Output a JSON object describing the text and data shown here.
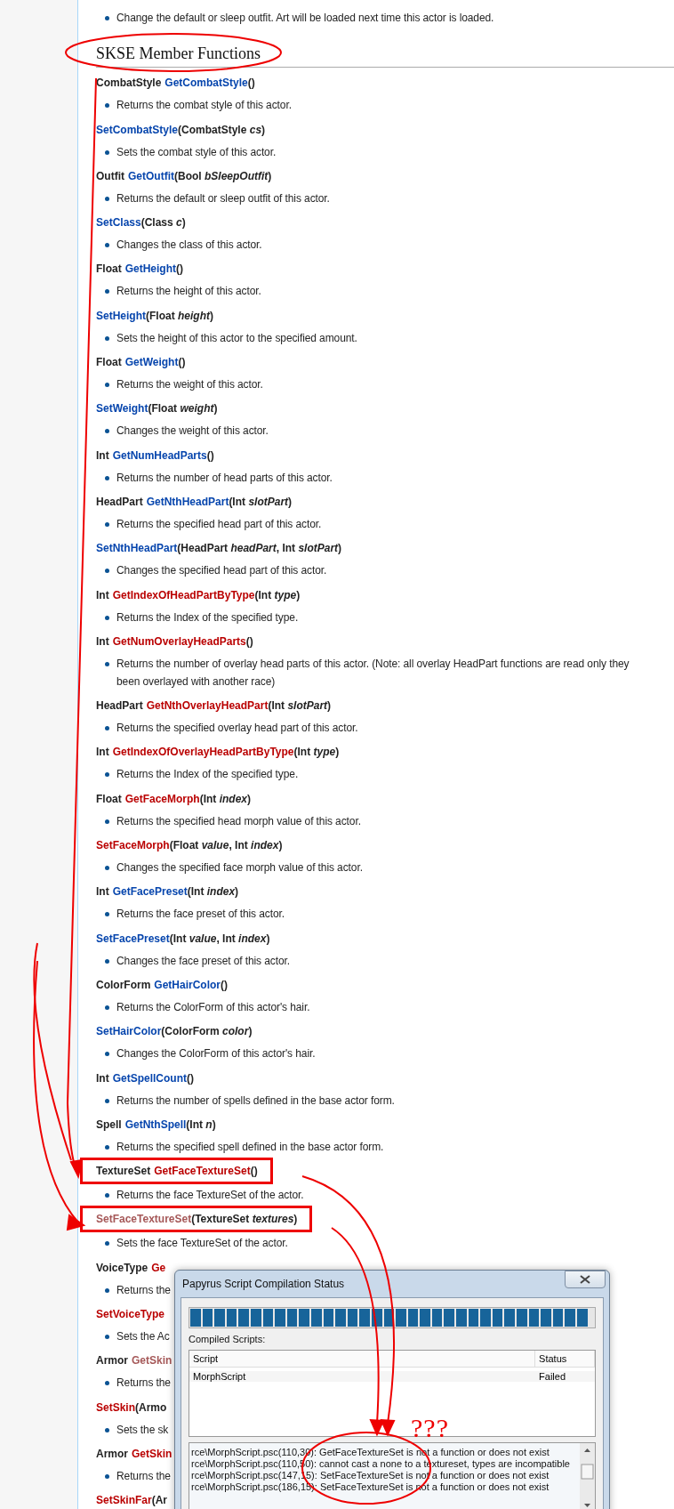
{
  "intro_note": "Change the default or sleep outfit. Art will be loaded next time this actor is loaded.",
  "section": {
    "title": "SKSE Member Functions",
    "circled": true
  },
  "functions": [
    {
      "return_type": "CombatStyle",
      "name": "GetCombatStyle",
      "kind": "blue",
      "params": "()",
      "boxed": false,
      "description": [
        "Returns the combat style of this actor."
      ]
    },
    {
      "name": "SetCombatStyle",
      "kind": "blue",
      "params": "(CombatStyle *cs*)",
      "boxed": false,
      "description": [
        "Sets the combat style of this actor."
      ]
    },
    {
      "return_type": "Outfit",
      "name": "GetOutfit",
      "kind": "blue",
      "params": "(Bool *bSleepOutfit*)",
      "boxed": false,
      "description": [
        "Returns the default or sleep outfit of this actor."
      ]
    },
    {
      "name": "SetClass",
      "kind": "blue",
      "params": "(Class *c*)",
      "boxed": false,
      "description": [
        "Changes the class of this actor."
      ]
    },
    {
      "return_type": "Float",
      "name": "GetHeight",
      "kind": "blue",
      "params": "()",
      "boxed": false,
      "description": [
        "Returns the height of this actor."
      ]
    },
    {
      "name": "SetHeight",
      "kind": "blue",
      "params": "(Float *height*)",
      "boxed": false,
      "description": [
        "Sets the height of this actor to the specified amount."
      ]
    },
    {
      "return_type": "Float",
      "name": "GetWeight",
      "kind": "blue",
      "params": "()",
      "boxed": false,
      "description": [
        "Returns the weight of this actor."
      ]
    },
    {
      "name": "SetWeight",
      "kind": "blue",
      "params": "(Float *weight*)",
      "boxed": false,
      "description": [
        "Changes the weight of this actor."
      ]
    },
    {
      "return_type": "Int",
      "name": "GetNumHeadParts",
      "kind": "blue",
      "params": "()",
      "boxed": false,
      "description": [
        "Returns the number of head parts of this actor."
      ]
    },
    {
      "return_type": "HeadPart",
      "name": "GetNthHeadPart",
      "kind": "blue",
      "params": "(Int *slotPart*)",
      "boxed": false,
      "description": [
        "Returns the specified head part of this actor."
      ]
    },
    {
      "name": "SetNthHeadPart",
      "kind": "blue",
      "params": "(HeadPart *headPart*, Int *slotPart*)",
      "boxed": false,
      "description": [
        "Changes the specified head part of this actor."
      ]
    },
    {
      "return_type": "Int",
      "name": "GetIndexOfHeadPartByType",
      "kind": "red",
      "params": "(Int *type*)",
      "boxed": false,
      "description": [
        "Returns the Index of the specified type."
      ]
    },
    {
      "return_type": "Int",
      "name": "GetNumOverlayHeadParts",
      "kind": "red",
      "params": "()",
      "boxed": false,
      "description": [
        "Returns the number of overlay head parts of this actor. (Note: all overlay HeadPart functions are read only they",
        "been overlayed with another race)"
      ]
    },
    {
      "return_type": "HeadPart",
      "name": "GetNthOverlayHeadPart",
      "kind": "red",
      "params": "(Int *slotPart*)",
      "boxed": false,
      "description": [
        "Returns the specified overlay head part of this actor."
      ]
    },
    {
      "return_type": "Int",
      "name": "GetIndexOfOverlayHeadPartByType",
      "kind": "red",
      "params": "(Int *type*)",
      "boxed": false,
      "description": [
        "Returns the Index of the specified type."
      ]
    },
    {
      "return_type": "Float",
      "name": "GetFaceMorph",
      "kind": "red",
      "params": "(Int *index*)",
      "boxed": false,
      "description": [
        "Returns the specified head morph value of this actor."
      ]
    },
    {
      "name": "SetFaceMorph",
      "kind": "red",
      "params": "(Float *value*, Int *index*)",
      "boxed": false,
      "description": [
        "Changes the specified face morph value of this actor."
      ]
    },
    {
      "return_type": "Int",
      "name": "GetFacePreset",
      "kind": "blue",
      "params": "(Int *index*)",
      "boxed": false,
      "description": [
        "Returns the face preset of this actor."
      ]
    },
    {
      "name": "SetFacePreset",
      "kind": "blue",
      "params": "(Int *value*, Int *index*)",
      "boxed": false,
      "description": [
        "Changes the face preset of this actor."
      ]
    },
    {
      "return_type": "ColorForm",
      "name": "GetHairColor",
      "kind": "blue",
      "params": "()",
      "boxed": false,
      "description": [
        "Returns the ColorForm of this actor's hair."
      ]
    },
    {
      "name": "SetHairColor",
      "kind": "blue",
      "params": "(ColorForm *color*)",
      "boxed": false,
      "description": [
        "Changes the ColorForm of this actor's hair."
      ]
    },
    {
      "return_type": "Int",
      "name": "GetSpellCount",
      "kind": "blue",
      "params": "()",
      "boxed": false,
      "description": [
        "Returns the number of spells defined in the base actor form."
      ]
    },
    {
      "return_type": "Spell",
      "name": "GetNthSpell",
      "kind": "blue",
      "params": "(Int *n*)",
      "boxed": false,
      "description": [
        "Returns the specified spell defined in the base actor form."
      ]
    },
    {
      "return_type": "TextureSet",
      "name": "GetFaceTextureSet",
      "kind": "red",
      "params": "()",
      "boxed": true,
      "description": [
        "Returns the face TextureSet of the actor."
      ]
    },
    {
      "name": "SetFaceTextureSet",
      "kind": "visited",
      "params": "(TextureSet *textures*)",
      "boxed": true,
      "description": [
        "Sets the face TextureSet of the actor."
      ]
    },
    {
      "return_type": "VoiceType",
      "name": "Ge",
      "kind": "red",
      "boxed": false,
      "description": [
        "Returns the"
      ]
    },
    {
      "name": "SetVoiceType",
      "kind": "red",
      "boxed": false,
      "description": [
        "Sets the Ac"
      ]
    },
    {
      "return_type": "Armor",
      "name": "GetSkin",
      "kind": "visited",
      "boxed": false,
      "description": [
        "Returns the"
      ]
    },
    {
      "name": "SetSkin",
      "kind": "red",
      "params": "(Armo",
      "boxed": false,
      "description": [
        "Sets the sk"
      ]
    },
    {
      "return_type": "Armor",
      "name": "GetSkin",
      "kind": "red",
      "boxed": false,
      "description": [
        "Returns the"
      ]
    },
    {
      "name": "SetSkinFar",
      "kind": "red",
      "params": "(Ar",
      "boxed": false
    }
  ],
  "annotation": {
    "text": "???"
  },
  "dialog": {
    "title": "Papyrus Script Compilation Status",
    "progress": {
      "level": 1
    },
    "compiled_label": "Compiled Scripts:",
    "table": {
      "columns": [
        "Script",
        "Status"
      ],
      "rows": [
        [
          "MorphScript",
          "Failed"
        ]
      ]
    },
    "output": [
      "rce\\MorphScript.psc(110,30): GetFaceTextureSet is not a function or does not exist",
      "rce\\MorphScript.psc(110,50): cannot cast a none to a textureset, types are incompatible",
      "rce\\MorphScript.psc(147,15): SetFaceTextureSet is not a function or does not exist",
      "rce\\MorphScript.psc(186,15): SetFaceTextureSet is not a function or does not exist"
    ]
  }
}
